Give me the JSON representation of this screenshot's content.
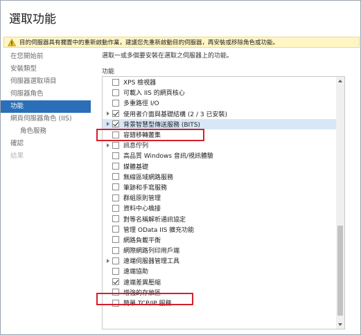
{
  "title": "選取功能",
  "warning": "目的伺服器具有擱置中的重新啟動作業，建議您先重新啟動目的伺服器，再安裝或移除角色或功能。",
  "sidebar": [
    {
      "label": "在您開始前",
      "state": "normal",
      "indent": 0
    },
    {
      "label": "安裝類型",
      "state": "normal",
      "indent": 0
    },
    {
      "label": "伺服器選取項目",
      "state": "normal",
      "indent": 0
    },
    {
      "label": "伺服器角色",
      "state": "normal",
      "indent": 0
    },
    {
      "label": "功能",
      "state": "active",
      "indent": 0
    },
    {
      "label": "網頁伺服器角色 (IIS)",
      "state": "normal",
      "indent": 0
    },
    {
      "label": "角色服務",
      "state": "normal",
      "indent": 1
    },
    {
      "label": "確認",
      "state": "normal",
      "indent": 0
    },
    {
      "label": "結果",
      "state": "dim",
      "indent": 0
    }
  ],
  "description": "選取一或多個要安裝在選取之伺服器上的功能。",
  "features_label": "功能",
  "features": [
    {
      "label": "XPS 檢視器",
      "checked": false,
      "expandable": false
    },
    {
      "label": "可載入 IIS 的網頁核心",
      "checked": false,
      "expandable": false
    },
    {
      "label": "多重路徑 I/O",
      "checked": false,
      "expandable": false
    },
    {
      "label": "使用者介面與基礎結構 (2 / 3 已安裝)",
      "checked": true,
      "expandable": true
    },
    {
      "label": "背景智慧型傳送服務 (BITS)",
      "checked": true,
      "expandable": true,
      "selected": true
    },
    {
      "label": "容錯移轉叢集",
      "checked": false,
      "expandable": false
    },
    {
      "label": "訊息佇列",
      "checked": false,
      "expandable": true
    },
    {
      "label": "高品質 Windows 音訊/視訊體驗",
      "checked": false,
      "expandable": false
    },
    {
      "label": "媒體基礎",
      "checked": false,
      "expandable": false
    },
    {
      "label": "無線區域網路服務",
      "checked": false,
      "expandable": false
    },
    {
      "label": "筆跡和手寫服務",
      "checked": false,
      "expandable": false
    },
    {
      "label": "群組原則管理",
      "checked": false,
      "expandable": false
    },
    {
      "label": "資料中心橋接",
      "checked": false,
      "expandable": false
    },
    {
      "label": "對等名稱解析通訊協定",
      "checked": false,
      "expandable": false
    },
    {
      "label": "管理 OData IIS 擴充功能",
      "checked": false,
      "expandable": false
    },
    {
      "label": "網路負載平衡",
      "checked": false,
      "expandable": false
    },
    {
      "label": "網際網路列印用戶端",
      "checked": false,
      "expandable": false
    },
    {
      "label": "遠端伺服器管理工具",
      "checked": false,
      "expandable": true
    },
    {
      "label": "遠端協助",
      "checked": false,
      "expandable": false
    },
    {
      "label": "遠端差異壓縮",
      "checked": true,
      "expandable": false
    },
    {
      "label": "增強的存放區",
      "checked": false,
      "expandable": false
    },
    {
      "label": "簡單 TCP/IP 服務",
      "checked": false,
      "expandable": false
    }
  ]
}
